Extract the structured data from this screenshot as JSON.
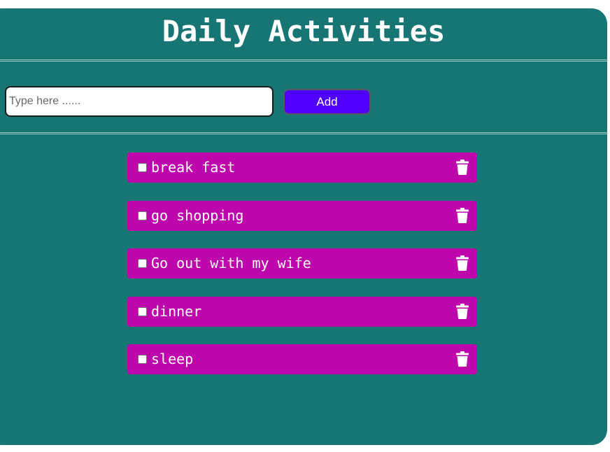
{
  "header": {
    "title": "Daily Activities"
  },
  "form": {
    "input_value": "",
    "input_placeholder": "Type here ......",
    "add_label": "Add"
  },
  "tasks": [
    {
      "label": "break fast",
      "done": false
    },
    {
      "label": "go shopping",
      "done": false
    },
    {
      "label": "Go out with my wife",
      "done": false
    },
    {
      "label": "dinner",
      "done": false
    },
    {
      "label": "sleep",
      "done": false
    }
  ],
  "icons": {
    "delete": "trash-icon"
  },
  "colors": {
    "app_background": "#177673",
    "item_background": "#bd07ad",
    "button_background": "#5000ff",
    "text": "#ffffff"
  }
}
